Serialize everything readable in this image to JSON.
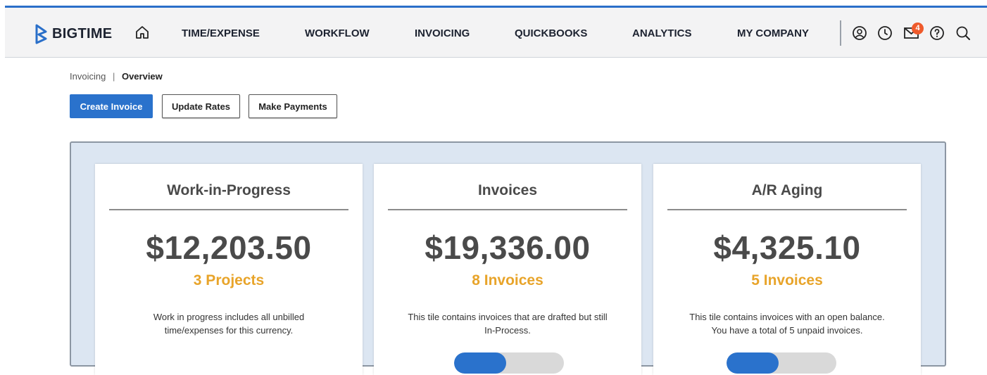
{
  "brand": {
    "name": "BIGTIME",
    "accent": "#2a72cc"
  },
  "nav": {
    "home_icon": "home-icon",
    "items": [
      "TIME/EXPENSE",
      "WORKFLOW",
      "INVOICING",
      "QUICKBOOKS",
      "ANALYTICS",
      "MY COMPANY"
    ],
    "icons": [
      "user-circle-icon",
      "clock-icon",
      "mail-icon",
      "help-icon",
      "search-icon"
    ],
    "mail_badge": "4"
  },
  "breadcrumb": {
    "parent": "Invoicing",
    "separator": "|",
    "current": "Overview"
  },
  "actions": {
    "create_invoice": "Create Invoice",
    "update_rates": "Update Rates",
    "make_payments": "Make Payments"
  },
  "cards": [
    {
      "title": "Work-in-Progress",
      "amount": "$12,203.50",
      "count": "3 Projects",
      "desc_line1": "Work in progress includes all unbilled",
      "desc_line2": "time/expenses for this currency."
    },
    {
      "title": "Invoices",
      "amount": "$19,336.00",
      "count": "8 Invoices",
      "desc_line1": "This tile contains invoices that are drafted but still",
      "desc_line2": "In-Process."
    },
    {
      "title": "A/R Aging",
      "amount": "$4,325.10",
      "count": "5 Invoices",
      "desc_line1": "This tile contains invoices with an open balance.",
      "desc_line2": "You have a total of 5 unpaid invoices."
    }
  ],
  "colors": {
    "count": "#e8a42a",
    "panel_bg": "#dce6f2",
    "badge": "#ef5a2b",
    "topbar_border": "#2a6fc9"
  }
}
